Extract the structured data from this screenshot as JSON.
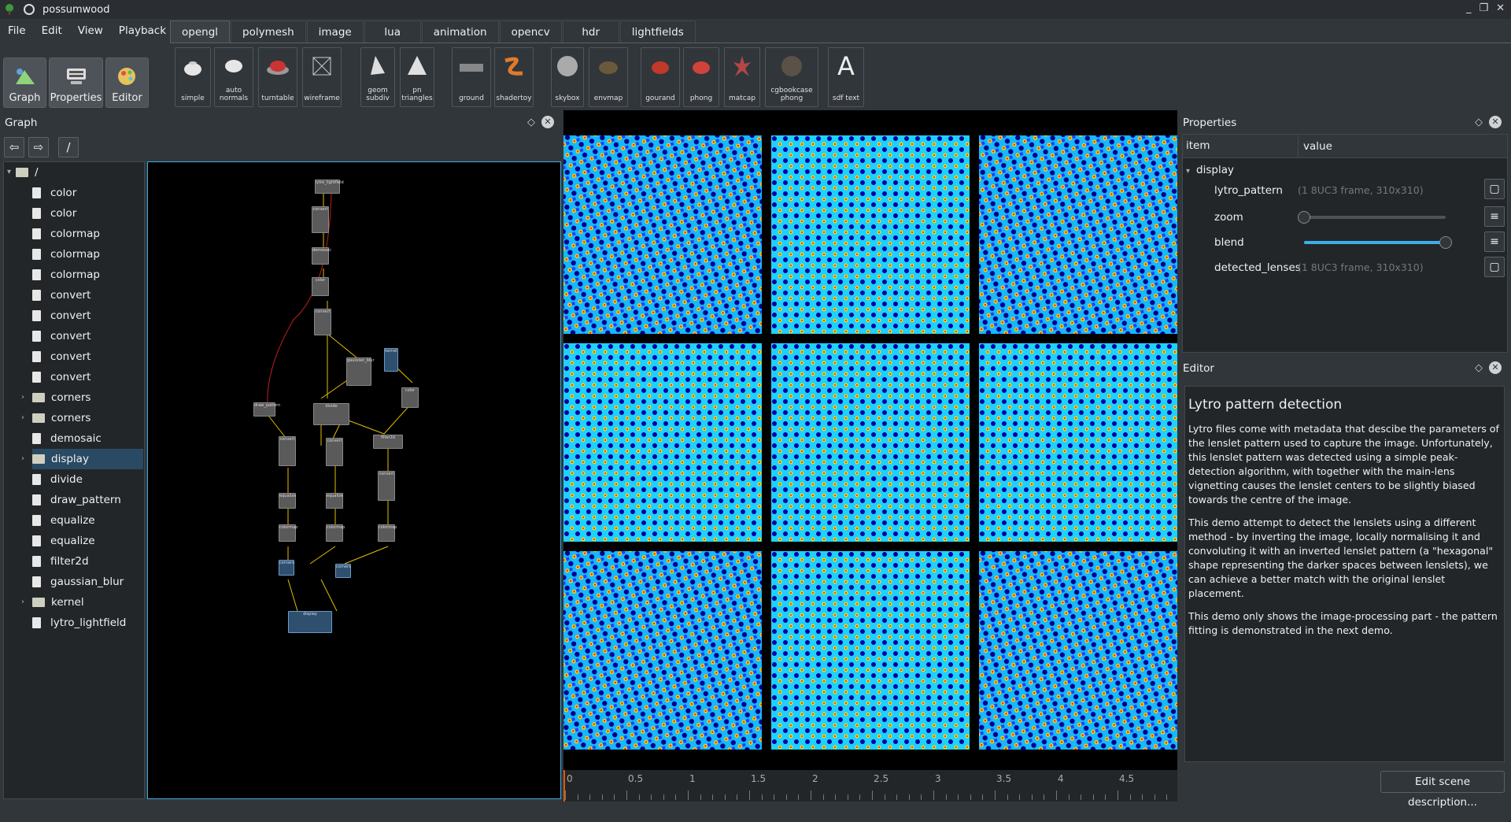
{
  "window": {
    "title": "possumwood",
    "controls": [
      "_",
      "❐",
      "✕"
    ]
  },
  "menu": [
    "File",
    "Edit",
    "View",
    "Playback"
  ],
  "modes": [
    {
      "label": "Graph",
      "icon": "graph-icon"
    },
    {
      "label": "Properties",
      "icon": "properties-icon"
    },
    {
      "label": "Editor",
      "icon": "editor-icon"
    }
  ],
  "tabs": [
    "opengl",
    "polymesh",
    "image",
    "lua",
    "animation",
    "opencv",
    "hdr",
    "lightfields"
  ],
  "active_tab": "opengl",
  "tools": [
    {
      "label": "simple",
      "icon": "teapot-icon"
    },
    {
      "label": "auto normals",
      "icon": "teapot-icon"
    },
    {
      "label": "turntable",
      "icon": "turntable-icon"
    },
    {
      "label": "wireframe",
      "icon": "wireframe-icon"
    },
    {
      "label": "geom subdiv",
      "icon": "subdiv-icon"
    },
    {
      "label": "pn triangles",
      "icon": "cone-icon"
    },
    {
      "label": "ground",
      "icon": "ground-icon"
    },
    {
      "label": "shadertoy",
      "icon": "shadertoy-icon"
    },
    {
      "label": "skybox",
      "icon": "skybox-icon"
    },
    {
      "label": "envmap",
      "icon": "envmap-icon"
    },
    {
      "label": "gourand",
      "icon": "teapot-red-icon"
    },
    {
      "label": "phong",
      "icon": "teapot-red-icon"
    },
    {
      "label": "matcap",
      "icon": "matcap-icon"
    },
    {
      "label": "cgbookcase phong",
      "icon": "sphere-icon"
    },
    {
      "label": "sdf text",
      "icon": "text-icon",
      "glyph": "A"
    }
  ],
  "graph_panel": {
    "title": "Graph",
    "path": "/",
    "root": "/",
    "items": [
      {
        "label": "color",
        "type": "file"
      },
      {
        "label": "color",
        "type": "file"
      },
      {
        "label": "colormap",
        "type": "file"
      },
      {
        "label": "colormap",
        "type": "file"
      },
      {
        "label": "colormap",
        "type": "file"
      },
      {
        "label": "convert",
        "type": "file"
      },
      {
        "label": "convert",
        "type": "file"
      },
      {
        "label": "convert",
        "type": "file"
      },
      {
        "label": "convert",
        "type": "file"
      },
      {
        "label": "convert",
        "type": "file"
      },
      {
        "label": "corners",
        "type": "folder"
      },
      {
        "label": "corners",
        "type": "folder"
      },
      {
        "label": "demosaic",
        "type": "file"
      },
      {
        "label": "display",
        "type": "folder",
        "selected": true
      },
      {
        "label": "divide",
        "type": "file"
      },
      {
        "label": "draw_pattern",
        "type": "file"
      },
      {
        "label": "equalize",
        "type": "file"
      },
      {
        "label": "equalize",
        "type": "file"
      },
      {
        "label": "filter2d",
        "type": "file"
      },
      {
        "label": "gaussian_blur",
        "type": "file"
      },
      {
        "label": "kernel",
        "type": "folder"
      },
      {
        "label": "lytro_lightfield",
        "type": "file"
      }
    ]
  },
  "graph_nodes": [
    "lytro_lightfield",
    "convert",
    "demosaic",
    "color",
    "convert",
    "gaussian_blur",
    "kernel",
    "color",
    "draw_pattern",
    "divide",
    "filter2d",
    "convert",
    "convert",
    "convert",
    "equalize",
    "equalize",
    "colormap",
    "colormap",
    "colormap",
    "corners",
    "corners",
    "display"
  ],
  "timeline": {
    "ticks": [
      "0",
      "0.5",
      "1",
      "1.5",
      "2",
      "2.5",
      "3",
      "3.5",
      "4",
      "4.5"
    ]
  },
  "properties": {
    "title": "Properties",
    "col_item": "item",
    "col_value": "value",
    "group": "display",
    "rows": [
      {
        "name": "lytro_pattern",
        "value": "(1 8UC3 frame, 310x310)"
      },
      {
        "name": "zoom",
        "slider": 0.0
      },
      {
        "name": "blend",
        "slider": 1.0
      },
      {
        "name": "detected_lenses",
        "value": "(1 8UC3 frame, 310x310)"
      }
    ]
  },
  "editor": {
    "title": "Editor",
    "heading": "Lytro pattern detection",
    "paragraphs": [
      "Lytro files come with metadata that descibe the parameters of the lenslet pattern used to capture the image. Unfortunately, this lenslet pattern was detected using a simple peak-detection algorithm, with together with the main-lens vignetting causes the lenslet centers to be slightly biased towards the centre of the image.",
      "This demo attempt to detect the lenslets using a different method - by inverting the image, locally normalising it and convoluting it with an inverted lenslet pattern (a \"hexagonal\" shape representing the darker spaces between lenslets), we can achieve a better match with the original lenslet placement.",
      "This demo only shows the image-processing part - the pattern fitting is demonstrated in the next demo."
    ],
    "button": "Edit scene description..."
  },
  "colors": {
    "accent": "#3daee9",
    "bg": "#31363b",
    "panel": "#232629"
  }
}
